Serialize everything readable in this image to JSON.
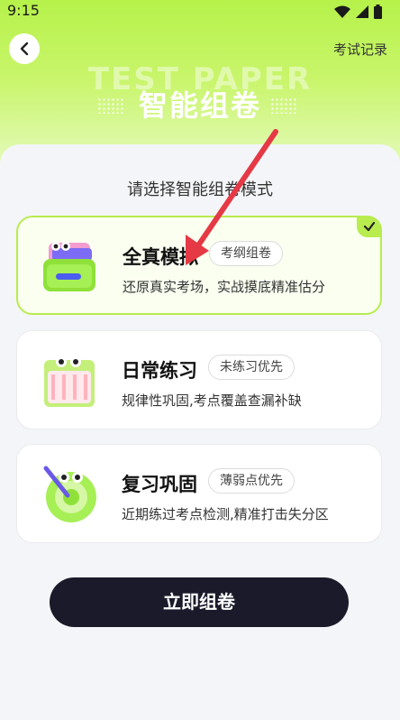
{
  "status_bar": {
    "time": "9:15"
  },
  "header": {
    "record_link": "考试记录",
    "hero_bg_text": "TEST PAPER",
    "hero_title": "智能组卷"
  },
  "subtitle": "请选择智能组卷模式",
  "modes": [
    {
      "name": "全真模拟",
      "tag": "考纲组卷",
      "desc": "还原真实考场，实战摸底精准估分",
      "selected": true
    },
    {
      "name": "日常练习",
      "tag": "未练习优先",
      "desc": "规律性巩固,考点覆盖查漏补缺",
      "selected": false
    },
    {
      "name": "复习巩固",
      "tag": "薄弱点优先",
      "desc": "近期练过考点检测,精准打击失分区",
      "selected": false
    }
  ],
  "cta_label": "立即组卷",
  "colors": {
    "accent": "#b8ec4f",
    "button_bg": "#1a1a2a",
    "arrow": "#e53945"
  }
}
